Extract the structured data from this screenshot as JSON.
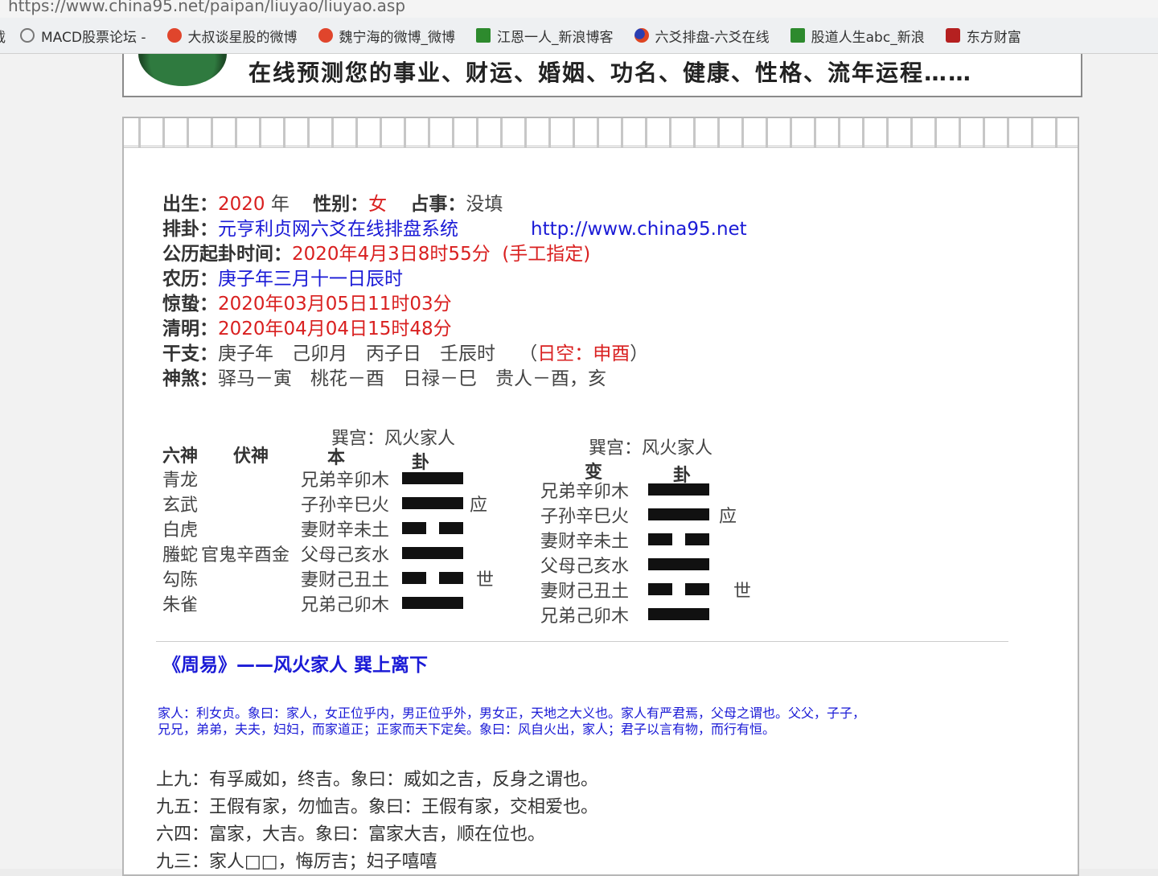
{
  "browser": {
    "url": "https://www.china95.net/paipan/liuyao/liuyao.asp",
    "bookmarks": [
      "载",
      "MACD股票论坛 -",
      "大叔谈星股的微博",
      "魏宁海的微博_微博",
      "江恩一人_新浪博客",
      "六爻排盘-六爻在线",
      "股道人生abc_新浪",
      "东方财富"
    ]
  },
  "banner": {
    "text": "在线预测您的事业、财运、婚姻、功名、健康、性格、流年运程……"
  },
  "info": {
    "birth_label": "出生：",
    "birth_year": "2020",
    "year_unit": "年",
    "gender_label": "性别：",
    "gender": "女",
    "matter_label": "占事：",
    "matter": "没填",
    "system_label": "排卦：",
    "system": "元亨利贞网六爻在线排盘系统",
    "site": "http://www.china95.net",
    "time_label": "公历起卦时间：",
    "time": "2020年4月3日8时55分",
    "time_note": "(手工指定)",
    "lunar_label": "农历：",
    "lunar": "庚子年三月十一日辰时",
    "jingzhe_label": "惊蛰：",
    "jingzhe": "2020年03月05日11时03分",
    "qingming_label": "清明：",
    "qingming": "2020年04月04日15时48分",
    "ganzhi_label": "干支：",
    "ganzhi": "庚子年　己卯月　丙子日　壬辰时",
    "kong_open": "（",
    "kong": "日空：申酉",
    "kong_close": "）",
    "shensha_label": "神煞：",
    "shensha": "驿马－寅　桃花－酉　日禄－巳　贵人－酉，亥"
  },
  "hexagram": {
    "liushen_header": "六神",
    "fushen_header": "伏神",
    "ben_palace": "巽宫：风火家人",
    "ben_header_1": "本",
    "ben_header_2": "卦",
    "bian_palace": "巽宫：风火家人",
    "bian_header_1": "变",
    "bian_header_2": "卦",
    "liushen": [
      "青龙",
      "玄武",
      "白虎",
      "螣蛇",
      "勾陈",
      "朱雀"
    ],
    "fushen": [
      "",
      "",
      "",
      "官鬼辛酉金",
      "",
      ""
    ],
    "ben_lines": [
      "兄弟辛卯木",
      "子孙辛巳火",
      "妻财辛未土",
      "父母己亥水",
      "妻财己丑土",
      "兄弟己卯木"
    ],
    "bian_lines": [
      "兄弟辛卯木",
      "子孙辛巳火",
      "妻财辛未土",
      "父母己亥水",
      "妻财己丑土",
      "兄弟己卯木"
    ],
    "ben_types": [
      "yang",
      "yang",
      "yin",
      "yang",
      "yin",
      "yang"
    ],
    "bian_types": [
      "yang",
      "yang",
      "yin",
      "yang",
      "yin",
      "yang"
    ],
    "ying": "应",
    "shi": "世"
  },
  "zhouyi": {
    "title": "《周易》——风火家人 巽上离下",
    "judgment_1": "家人：利女贞。象曰：家人，女正位乎内，男正位乎外，男女正，天地之大义也。家人有严君焉，父母之谓也。父父，子子，",
    "judgment_2": "兄兄，弟弟，夫夫，妇妇，而家道正；正家而天下定矣。象曰：风自火出，家人；君子以言有物，而行有恒。",
    "yao": [
      "上九：有孚威如，终吉。象曰：威如之吉，反身之谓也。",
      "九五：王假有家，勿恤吉。象曰：王假有家，交相爱也。",
      "六四：富家，大吉。象曰：富家大吉，顺在位也。",
      "九三：家人□□，悔厉吉；妇子嘻嘻"
    ]
  },
  "colors": {
    "red": "#d92020",
    "blue": "#1a1ad6",
    "text": "#444444"
  }
}
